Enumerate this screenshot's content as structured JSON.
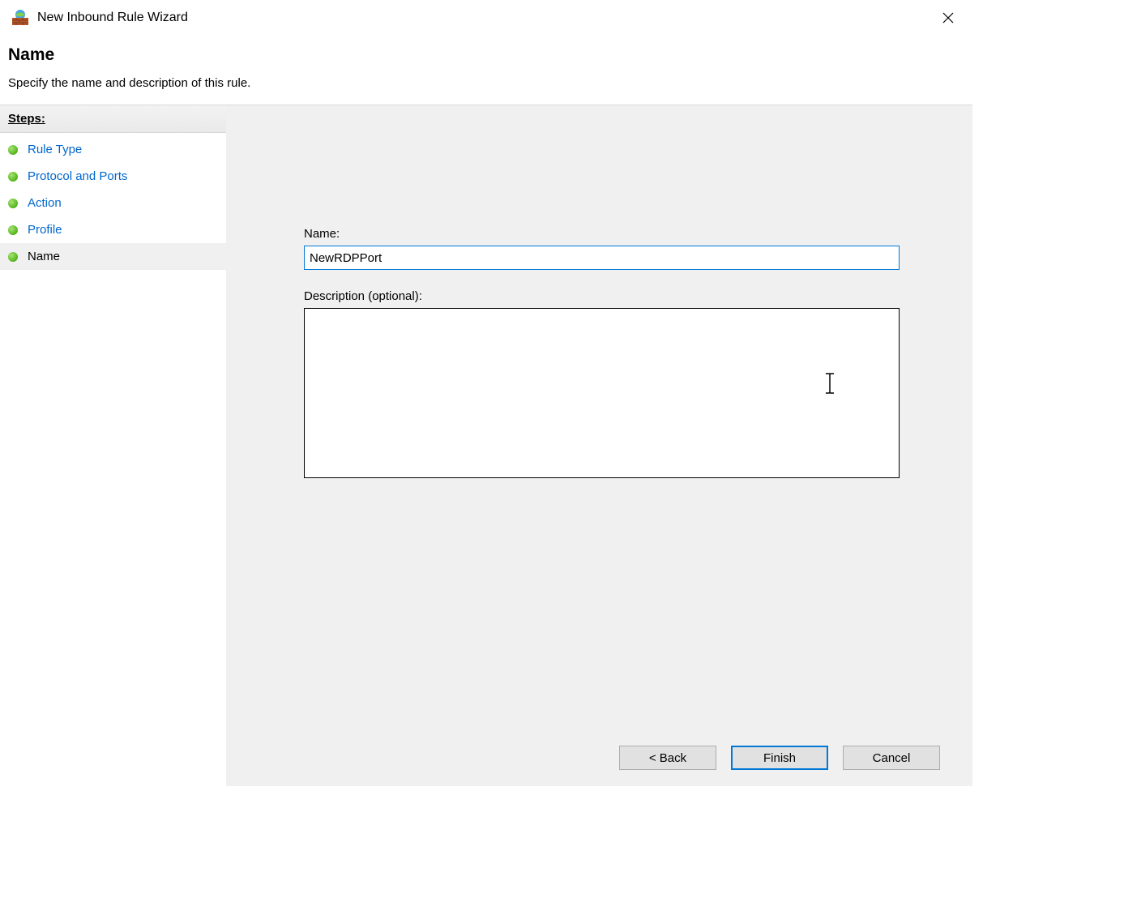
{
  "window": {
    "title": "New Inbound Rule Wizard"
  },
  "header": {
    "page_title": "Name",
    "page_subtitle": "Specify the name and description of this rule."
  },
  "sidebar": {
    "header": "Steps:",
    "steps": [
      {
        "label": "Rule Type",
        "link": true,
        "current": false
      },
      {
        "label": "Protocol and Ports",
        "link": true,
        "current": false
      },
      {
        "label": "Action",
        "link": true,
        "current": false
      },
      {
        "label": "Profile",
        "link": true,
        "current": false
      },
      {
        "label": "Name",
        "link": false,
        "current": true
      }
    ]
  },
  "form": {
    "name_label": "Name:",
    "name_value": "NewRDPPort",
    "description_label": "Description (optional):",
    "description_value": ""
  },
  "buttons": {
    "back": "< Back",
    "finish": "Finish",
    "cancel": "Cancel"
  }
}
